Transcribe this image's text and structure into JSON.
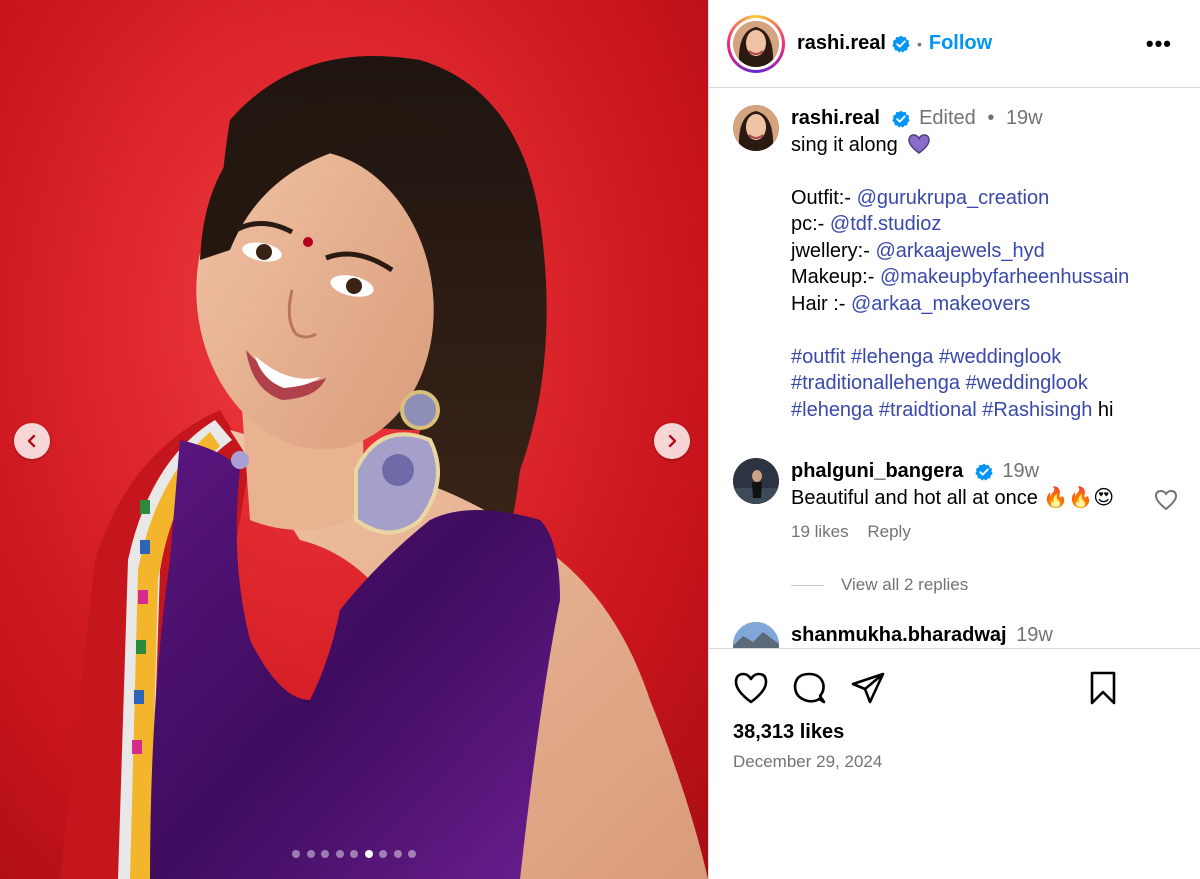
{
  "post": {
    "author": "rashi.real",
    "follow_label": "Follow",
    "more_label": "•••",
    "separator": "•"
  },
  "caption": {
    "username": "rashi.real",
    "edited_label": "Edited",
    "separator": "•",
    "time": "19w",
    "line1": "sing it along",
    "lines": [
      {
        "label": "Outfit:- ",
        "mention": "@gurukrupa_creation"
      },
      {
        "label": "pc:- ",
        "mention": "@tdf.studioz"
      },
      {
        "label": "jwellery:- ",
        "mention": "@arkaajewels_hyd"
      },
      {
        "label": "Makeup:- ",
        "mention": "@makeupbyfarheenhussain"
      },
      {
        "label": "Hair :- ",
        "mention": "@arkaa_makeovers"
      }
    ],
    "hashtags_line1": "#outfit #lehenga #weddinglook",
    "hashtags_line2": "#traditionallehenga #weddinglook",
    "hashtags_line3": "#lehenga #traidtional #Rashisingh",
    "trailing_text": " hi"
  },
  "comments": [
    {
      "username": "phalguni_bangera",
      "time": "19w",
      "text": "Beautiful and hot all at once",
      "emoji": "🔥🔥😍",
      "likes": "19 likes",
      "reply_label": "Reply",
      "view_replies": "View all 2 replies"
    },
    {
      "username": "shanmukha.bharadwaj",
      "time": "19w"
    }
  ],
  "footer": {
    "likes": "38,313 likes",
    "date": "December 29, 2024"
  },
  "carousel": {
    "total": 9,
    "active_index": 5
  },
  "colors": {
    "accent": "#0095f6",
    "link": "#3949ab",
    "muted": "#737373",
    "background_red": "#e0242b"
  },
  "icons": [
    "chevron-left-icon",
    "chevron-right-icon",
    "verified-icon",
    "heart-icon",
    "comment-icon",
    "share-icon",
    "bookmark-icon",
    "purple-heart-icon"
  ]
}
